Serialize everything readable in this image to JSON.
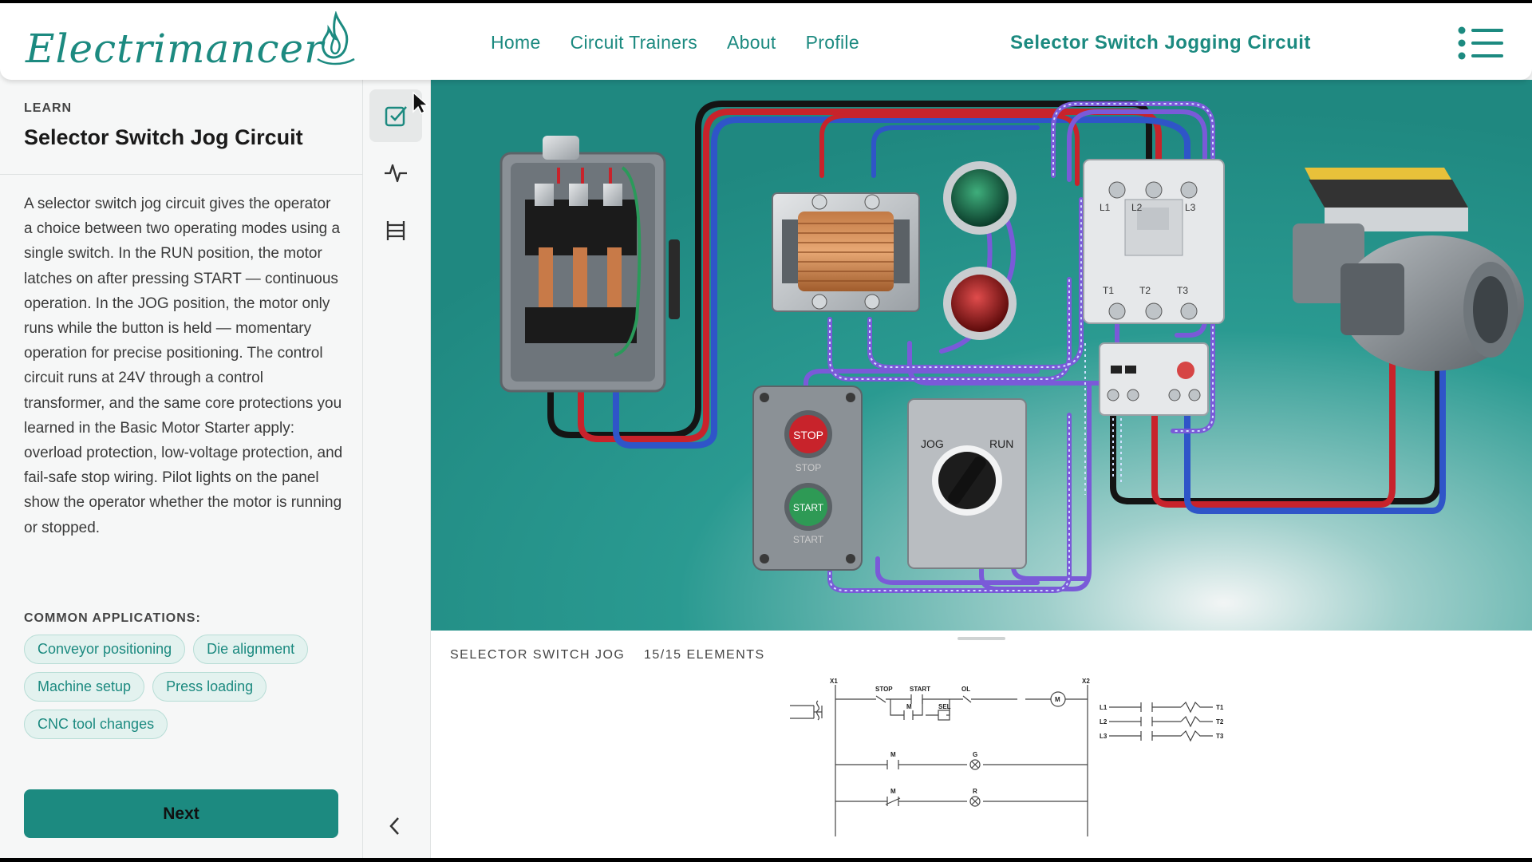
{
  "header": {
    "logo_text": "Electrimancer",
    "nav": [
      "Home",
      "Circuit Trainers",
      "About",
      "Profile"
    ],
    "page_heading": "Selector Switch Jogging Circuit",
    "menu_icon": "list-menu-icon"
  },
  "learn": {
    "label": "LEARN",
    "title": "Selector Switch Jog Circuit",
    "description": "A selector switch jog circuit gives the operator a choice between two operating modes using a single switch. In the RUN position, the motor latches on after pressing START — continuous operation. In the JOG position, the motor only runs while the button is held — momentary operation for precise positioning. The control circuit runs at 24V through a control transformer, and the same core protections you learned in the Basic Motor Starter apply: overload protection, low-voltage protection, and fail-safe stop wiring. Pilot lights on the panel show the operator whether the motor is running or stopped.",
    "applications_label": "COMMON APPLICATIONS:",
    "applications": [
      "Conveyor positioning",
      "Die alignment",
      "Machine setup",
      "Press loading",
      "CNC tool changes"
    ],
    "next_label": "Next"
  },
  "toolbar": {
    "tools": [
      "checklist-icon",
      "waveform-icon",
      "ladder-icon"
    ],
    "collapse": "chevron-left-icon"
  },
  "scene": {
    "stop_label": "STOP",
    "start_label": "START",
    "jog_label": "JOG",
    "run_label": "RUN",
    "contactor_labels": [
      "L1",
      "L2",
      "L3",
      "T1",
      "T2",
      "T3"
    ]
  },
  "schematic_panel": {
    "title": "SELECTOR SWITCH JOG",
    "count": "15/15 ELEMENTS",
    "labels": {
      "x1": "X1",
      "x2": "X2",
      "stop": "STOP",
      "start": "START",
      "ol": "OL",
      "motor": "M",
      "sel": "SEL",
      "g": "G",
      "r": "R",
      "l1": "L1",
      "l2": "L2",
      "l3": "L3",
      "t1": "T1",
      "t2": "T2",
      "t3": "T3"
    }
  },
  "colors": {
    "brand": "#1c8a80",
    "scene_bg": "#2d9a92",
    "wire_red": "#c8232b",
    "wire_blue": "#2f55c8",
    "wire_black": "#141414",
    "wire_control": "#7a5ad8"
  }
}
